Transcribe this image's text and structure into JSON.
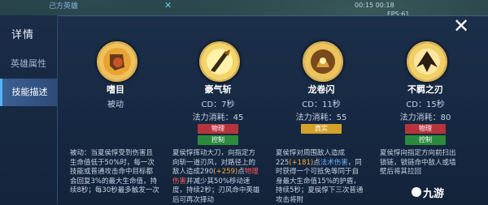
{
  "hud": {
    "team_label": "己方英雄",
    "stats": "00:15  00:18",
    "fps": "FPS:61"
  },
  "dialog": {
    "title": "详情",
    "tabs": [
      {
        "label": "英雄属性"
      },
      {
        "label": "技能描述"
      }
    ],
    "close_label": "✕"
  },
  "skills": [
    {
      "name": "嗜目",
      "sub": "被动",
      "mana": "",
      "tags": [],
      "desc_parts": [
        {
          "t": "被动：当夏侯惇受到伤害且生命值低于50%时，每一次技能或普通攻击命中目标都会回复3%的最大生命值，持续8秒；每30秒最多触发一次",
          "c": ""
        }
      ]
    },
    {
      "name": "豪气斩",
      "sub": "CD：7秒",
      "mana": "法力消耗：45",
      "tags": [
        {
          "label": "物理",
          "kind": "physical"
        },
        {
          "label": "控制",
          "kind": "control"
        }
      ],
      "desc_parts": [
        {
          "t": "夏侯惇挥动大刀，向指定方向斩一道刃风，对路径上的敌人造成290",
          "c": ""
        },
        {
          "t": "(+259)",
          "c": "orange"
        },
        {
          "t": "点",
          "c": ""
        },
        {
          "t": "物理伤害",
          "c": "red"
        },
        {
          "t": "并减少其50%移动速度，持续2秒；刃风命中英雄后可再次择动",
          "c": ""
        }
      ]
    },
    {
      "name": "龙卷闪",
      "sub": "CD：11秒",
      "mana": "法力消耗：55",
      "tags": [
        {
          "label": "真实",
          "kind": "true"
        }
      ],
      "desc_parts": [
        {
          "t": "夏侯惇对周围敌人造成225",
          "c": ""
        },
        {
          "t": "(+181)",
          "c": "orange"
        },
        {
          "t": "点",
          "c": ""
        },
        {
          "t": "法术伤害",
          "c": "blue"
        },
        {
          "t": "，同时获得一个可抵免等同于自身最大生命值15%的护盾，持续5秒；夏侯惇下三次普通攻击将附",
          "c": ""
        }
      ]
    },
    {
      "name": "不羁之刃",
      "sub": "CD：15秒",
      "mana": "法力消耗：80",
      "tags": [
        {
          "label": "物理",
          "kind": "physical"
        },
        {
          "label": "控制",
          "kind": "control"
        }
      ],
      "desc_parts": [
        {
          "t": "夏侯惇向指定方向前扫出锁链，锁链命中敌人或墙壁后将其拉回",
          "c": ""
        }
      ]
    }
  ],
  "watermark": "九游"
}
